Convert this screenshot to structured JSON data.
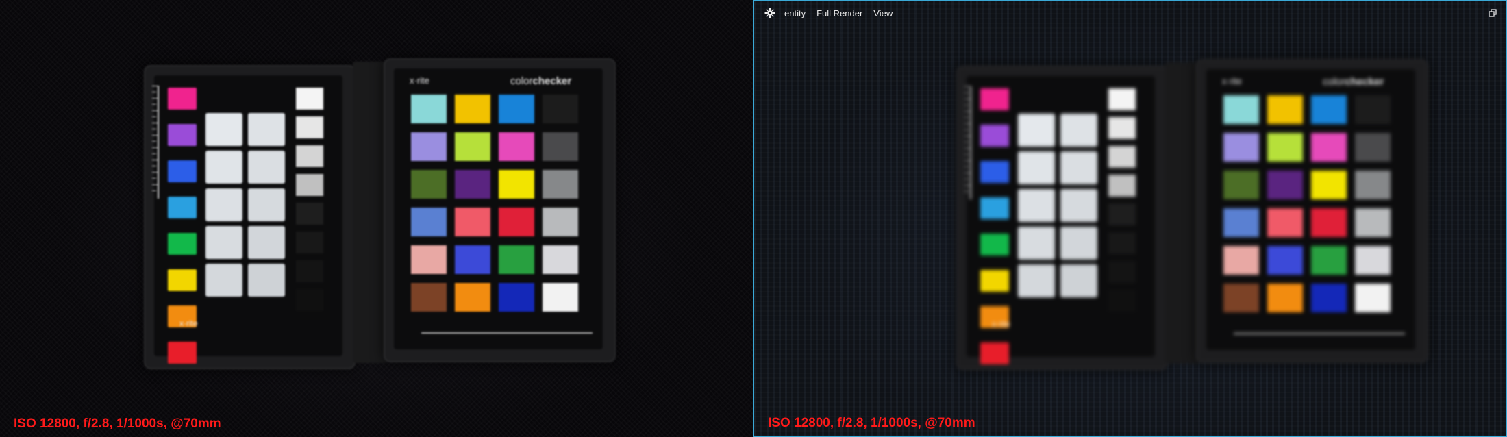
{
  "left_panel": {
    "caption": "ISO 12800, f/2.8, 1/1000s, @70mm"
  },
  "right_panel": {
    "toolbar": {
      "settings_icon": "gear-icon",
      "menu": [
        "entity",
        "Full Render",
        "View"
      ],
      "window_icon": "restore-window-icon"
    },
    "caption": "ISO 12800, f/2.8, 1/1000s, @70mm"
  },
  "checker": {
    "brand_left": "x·rite",
    "brand_right_light": "color",
    "brand_right_bold": "checker",
    "brand_bottom": "x·rite",
    "classic_colors": [
      [
        "#8ad8d8",
        "#f2c200",
        "#1883d8",
        "#1c1c1c"
      ],
      [
        "#9a8ee0",
        "#b6e03a",
        "#e64aba",
        "#4a4a4c"
      ],
      [
        "#4c6e26",
        "#5a2480",
        "#f2e400",
        "#86888a"
      ],
      [
        "#5a80d2",
        "#f05a68",
        "#e02038",
        "#b8babc"
      ],
      [
        "#e8a8a4",
        "#3c4ad8",
        "#28a040",
        "#d8d8dc"
      ],
      [
        "#7c4226",
        "#f28c10",
        "#1428b8",
        "#f2f2f2"
      ]
    ],
    "side_swatches": [
      "#f0238e",
      "#9a4cd8",
      "#2c5ee8",
      "#2aa0e0",
      "#12b84a",
      "#f2d600",
      "#f28c10",
      "#e81e2a"
    ],
    "white_steps": [
      "#f4f4f4",
      "#e6e6e6",
      "#d4d4d4",
      "#c0c0c0",
      "#1e1e1e",
      "#181818",
      "#141414",
      "#101010"
    ]
  }
}
